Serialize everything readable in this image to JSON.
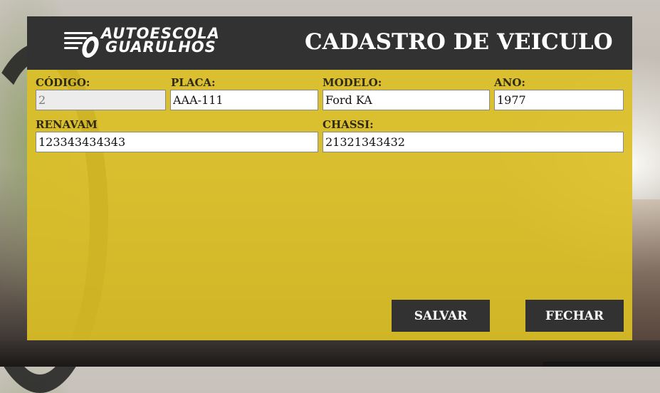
{
  "brand": {
    "line1": "AUTOESCOLA",
    "line2": "GUARULHOS"
  },
  "title": "CADASTRO DE VEICULO",
  "fields": {
    "codigo": {
      "label": "CÓDIGO:",
      "value": "2"
    },
    "placa": {
      "label": "PLACA:",
      "value": "AAA-111"
    },
    "modelo": {
      "label": "MODELO:",
      "value": "Ford KA"
    },
    "ano": {
      "label": "ANO:",
      "value": "1977"
    },
    "renavam": {
      "label": "RENAVAM",
      "value": "123343434343"
    },
    "chassi": {
      "label": "CHASSI:",
      "value": "21321343432"
    }
  },
  "buttons": {
    "save": "SALVAR",
    "close": "FECHAR"
  },
  "colors": {
    "panel": "#DBBF26",
    "header": "#323232",
    "button": "#323232"
  }
}
